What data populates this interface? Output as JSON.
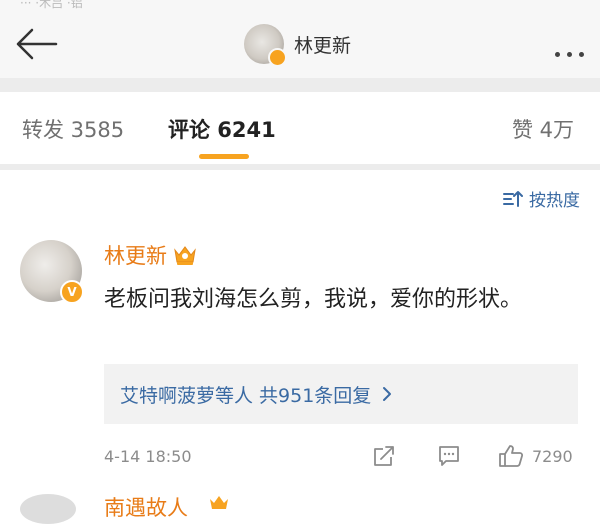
{
  "status_bar": {
    "text": "···  ·木吕 ·铝"
  },
  "header": {
    "title": "林更新",
    "more_label": "• • •"
  },
  "tabs": {
    "repost": "转发 3585",
    "comment": "评论 6241",
    "like": "赞 4万"
  },
  "sort": {
    "label": "按热度"
  },
  "comment": {
    "author": "林更新",
    "avatar_badge": "V",
    "text": "老板问我刘海怎么剪，我说，爱你的形状。",
    "replies_summary": "艾特啊菠萝等人  共951条回复",
    "time": "4-14 18:50",
    "likes": "7290"
  },
  "next_comment": {
    "author_partial": "南遇故人"
  },
  "colors": {
    "accent_orange": "#f7a320",
    "link_blue": "#3a6aa3",
    "author_orange": "#e87c18"
  },
  "icons": [
    "back-arrow-icon",
    "more-icon",
    "sort-icon",
    "crown-icon",
    "chevron-right-icon",
    "share-icon",
    "comment-icon",
    "like-icon"
  ]
}
